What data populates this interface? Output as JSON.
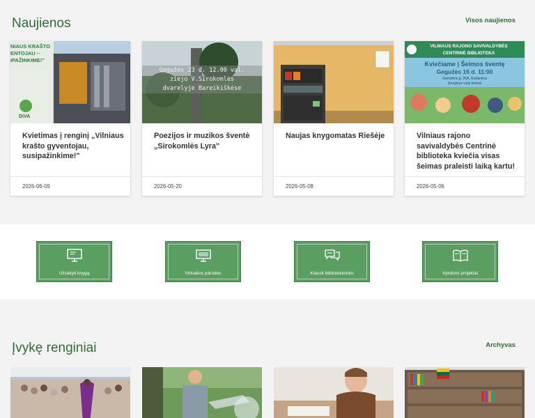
{
  "news": {
    "title": "Naujienos",
    "all_link": "Visos naujienos",
    "cards": [
      {
        "title": "Kvietimas į renginį „Vilniaus krašto gyventojau, susipažinkime!\"",
        "date": "2026-06-09",
        "img_text": [
          "NIAUS KRAŠTO",
          "ENTOJAU –",
          "IPAŽINKIME!\"",
          "DiVA"
        ]
      },
      {
        "title": "Poezijos ir muzikos šventė „Sirokomlės  Lyra\"",
        "date": "2026-05-20",
        "img_text": [
          "Gegužės 23 d. 12.00 val.",
          "ziejo V.Sirokomlės",
          "dvarelyje Bareikiškėse"
        ]
      },
      {
        "title": "Naujas knygomatas Riešėje",
        "date": "2026-05-08",
        "img_text": []
      },
      {
        "title": "Vilniaus rajono savivaldybės Centrinė biblioteka kviečia visas šeimas praleisti laiką kartu!",
        "date": "2026-05-06",
        "img_text": [
          "VILNIAUS RAJONO SAVIVALDYBĖS",
          "CENTRINĖ BIBLIOTEKA",
          "Kviečiame į Šeimos šventę",
          "Gegužės 16 d. 11:00",
          "Gamyklos g. 20A, Rudamina",
          "Renginys visai šeimai"
        ]
      }
    ]
  },
  "quick_links": [
    {
      "label": "Užsakyti knygą",
      "icon": "computer-book-icon"
    },
    {
      "label": "Virtualios parodos",
      "icon": "monitor-icon"
    },
    {
      "label": "Klausk bibliotekininko",
      "icon": "chat-bubbles-icon"
    },
    {
      "label": "Vykdomi projektai",
      "icon": "open-book-icon"
    }
  ],
  "events": {
    "title": "Įvykę renginiai",
    "archive_link": "Archyvas"
  },
  "colors": {
    "accent": "#2f6b34",
    "tile": "#5a9e62"
  }
}
